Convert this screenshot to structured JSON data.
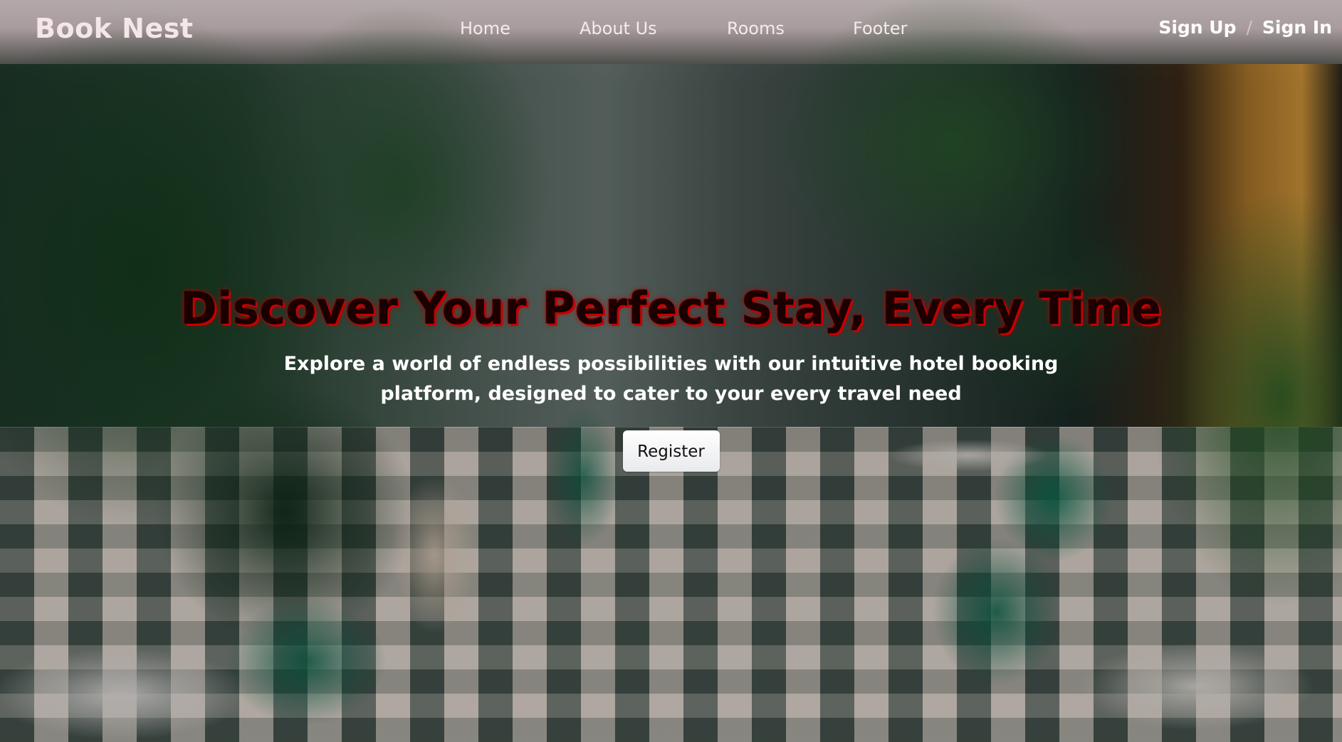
{
  "brand": {
    "name": "Book Nest"
  },
  "nav": {
    "items": [
      {
        "label": "Home"
      },
      {
        "label": "About Us"
      },
      {
        "label": "Rooms"
      },
      {
        "label": "Footer"
      }
    ]
  },
  "auth": {
    "sign_up": "Sign Up",
    "separator": "/",
    "sign_in": "Sign In"
  },
  "hero": {
    "title": "Discover Your Perfect Stay, Every Time",
    "subtitle": "Explore a world of endless possibilities with our intuitive hotel booking platform, designed to cater to your every travel need",
    "cta_label": "Register"
  },
  "colors": {
    "title_fill": "#1a0000",
    "title_shadow": "#c40000",
    "nav_text": "#f2ecec",
    "brand_text": "#f4e6ea",
    "button_bg": "#ffffff"
  }
}
